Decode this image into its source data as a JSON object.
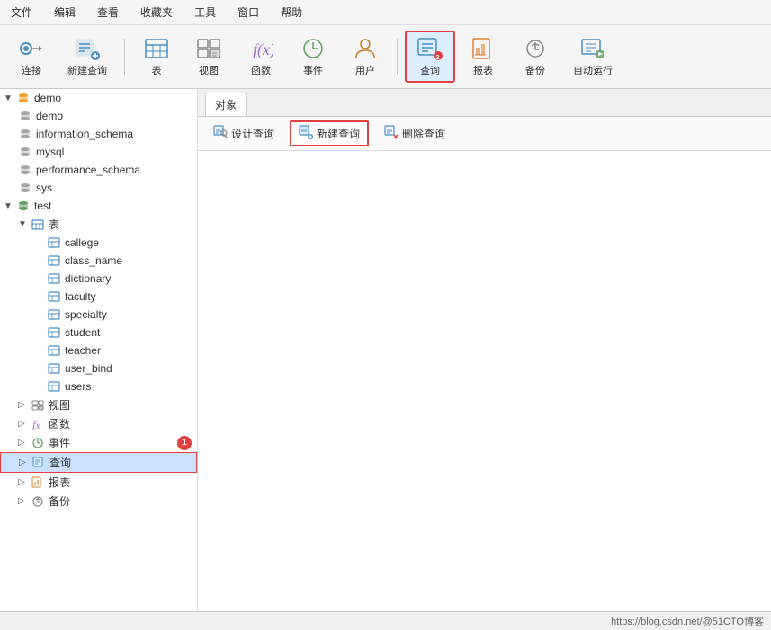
{
  "menubar": {
    "items": [
      "文件",
      "编辑",
      "查看",
      "收藏夹",
      "工具",
      "窗口",
      "帮助"
    ]
  },
  "toolbar": {
    "connect": {
      "label": "连接",
      "sublabel": ""
    },
    "new_query": {
      "label": "新建查询"
    },
    "table": {
      "label": "表"
    },
    "view": {
      "label": "视图"
    },
    "function": {
      "label": "函数"
    },
    "event": {
      "label": "事件"
    },
    "user": {
      "label": "用户"
    },
    "query": {
      "label": "查询"
    },
    "report": {
      "label": "报表"
    },
    "backup": {
      "label": "备份"
    },
    "autorun": {
      "label": "自动运行"
    }
  },
  "sidebar": {
    "root": "demo",
    "databases": [
      {
        "name": "demo",
        "type": "db"
      },
      {
        "name": "information_schema",
        "type": "db"
      },
      {
        "name": "mysql",
        "type": "db"
      },
      {
        "name": "performance_schema",
        "type": "db"
      },
      {
        "name": "sys",
        "type": "db"
      }
    ],
    "test_db": {
      "name": "test",
      "tables_label": "表",
      "tables": [
        "callege",
        "class_name",
        "dictionary",
        "faculty",
        "specialty",
        "student",
        "teacher",
        "user_bind",
        "users"
      ],
      "view_label": "视图",
      "func_label": "函数",
      "event_label": "事件",
      "query_label": "查询",
      "report_label": "报表",
      "backup_label": "备份"
    }
  },
  "content": {
    "tab_label": "对象",
    "toolbar": {
      "design": "设计查询",
      "new_query": "新建查询",
      "delete_query": "删除查询"
    }
  },
  "statusbar": {
    "url": "https://blog.csdn.net/@51CTO博客"
  },
  "badges": {
    "event_badge": "1",
    "query_toolbar_badge": "2"
  }
}
